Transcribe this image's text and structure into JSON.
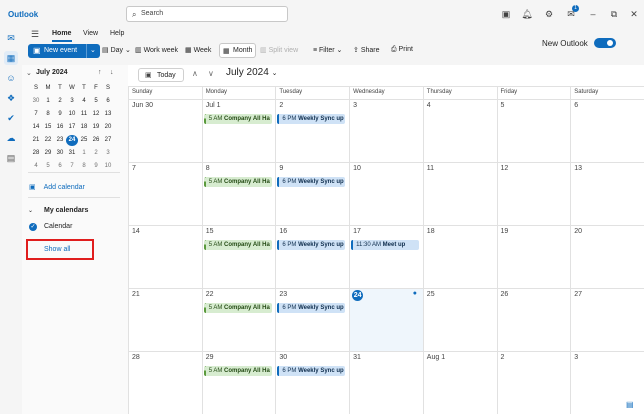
{
  "app": {
    "title": "Outlook"
  },
  "search": {
    "placeholder": "Search"
  },
  "titlebar_icons": [
    "present-icon",
    "bell-icon",
    "gear-icon",
    "megaphone-icon",
    "minimize-icon",
    "restore-icon",
    "close-icon"
  ],
  "notification_count": "1",
  "ribbon": {
    "tabs": [
      "Home",
      "View",
      "Help"
    ],
    "new_event": "New event",
    "day": "Day",
    "work_week": "Work week",
    "week": "Week",
    "month": "Month",
    "split_view": "Split view",
    "filter": "Filter",
    "share": "Share",
    "print": "Print",
    "new_outlook": "New Outlook"
  },
  "mini_calendar": {
    "title": "July 2024",
    "weekdays": [
      "S",
      "M",
      "T",
      "W",
      "T",
      "F",
      "S"
    ],
    "weeks": [
      [
        "30",
        "1",
        "2",
        "3",
        "4",
        "5",
        "6"
      ],
      [
        "7",
        "8",
        "9",
        "10",
        "11",
        "12",
        "13"
      ],
      [
        "14",
        "15",
        "16",
        "17",
        "18",
        "19",
        "20"
      ],
      [
        "21",
        "22",
        "23",
        "24",
        "25",
        "26",
        "27"
      ],
      [
        "28",
        "29",
        "30",
        "31",
        "1",
        "2",
        "3"
      ],
      [
        "4",
        "5",
        "6",
        "7",
        "8",
        "9",
        "10"
      ]
    ]
  },
  "left_pane": {
    "add_calendar": "Add calendar",
    "my_calendars": "My calendars",
    "calendar": "Calendar",
    "show_all": "Show all"
  },
  "calendar": {
    "today": "Today",
    "title": "July 2024",
    "weekdays": [
      "Sunday",
      "Monday",
      "Tuesday",
      "Wednesday",
      "Thursday",
      "Friday",
      "Saturday"
    ],
    "weeks": [
      [
        "Jun 30",
        "Jul 1",
        "2",
        "3",
        "4",
        "5",
        "6"
      ],
      [
        "7",
        "8",
        "9",
        "10",
        "11",
        "12",
        "13"
      ],
      [
        "14",
        "15",
        "16",
        "17",
        "18",
        "19",
        "20"
      ],
      [
        "21",
        "22",
        "23",
        "24",
        "25",
        "26",
        "27"
      ],
      [
        "28",
        "29",
        "30",
        "31",
        "Aug 1",
        "2",
        "3"
      ]
    ],
    "events": {
      "all_hands_time": "5 AM",
      "all_hands_title": "Company All Ha",
      "weekly_time": "6 PM",
      "weekly_title": "Weekly Sync up",
      "meetup_time": "11:30 AM",
      "meetup_title": "Meet up"
    }
  },
  "colors": {
    "accent": "#0f6cbd",
    "highlight": "#e01e1e"
  }
}
